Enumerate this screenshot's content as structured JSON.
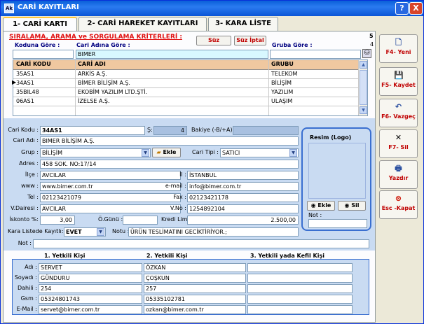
{
  "window": {
    "title": "CARİ KAYITLARI",
    "help_label": "?",
    "close_label": "X",
    "app_icon": "Ak"
  },
  "tabs": [
    {
      "label": "1- CARİ KARTI",
      "active": true
    },
    {
      "label": "2- CARİ HAREKET KAYITLARI",
      "active": false
    },
    {
      "label": "3- KARA LİSTE",
      "active": false
    }
  ],
  "search": {
    "heading": "SIRALAMA, ARAMA ve SORGULAMA KRİTERLERİ :",
    "filter_button": "Süz",
    "cancel_filter_button": "Süz İptal",
    "count_total": "5",
    "count_shown": "4",
    "code_label": "Koduna Göre :",
    "name_label": "Cari Adına Göre :",
    "group_label": "Gruba Göre :",
    "code_value": "",
    "name_value": "BIMER",
    "group_value": ""
  },
  "grid": {
    "columns": [
      "CARİ KODU",
      "CARİ ADI",
      "GRUBU"
    ],
    "rows": [
      {
        "code": "35AS1",
        "name": "ARKİS A.Ş.",
        "group": "TELEKOM",
        "selected": false
      },
      {
        "code": "34AS1",
        "name": "BİMER BİLİŞİM A.Ş.",
        "group": "BİLİŞİM",
        "selected": true
      },
      {
        "code": "35BIL48",
        "name": "EKOBİM YAZILIM LTD.ŞTİ.",
        "group": "YAZILIM",
        "selected": false
      },
      {
        "code": "06AS1",
        "name": "İZELSE A.Ş.",
        "group": "ULAŞIM",
        "selected": false
      }
    ]
  },
  "form": {
    "code_label": "Cari Kodu :",
    "code_value": "34AS1",
    "s_label": "Ş:",
    "s_value": "4",
    "balance_label": "Bakiye (-B/+A):",
    "balance_value": "",
    "name_label": "Cari Adı :",
    "name_value": "BIMER BİLİŞİM A.Ş.",
    "group_label": "Grup :",
    "group_value": "BİLİŞİM",
    "add_button": "Ekle",
    "type_label": "Cari Tipi :",
    "type_value": "SATICI",
    "address_label": "Adres :",
    "address_value": "458 SOK. NO:17/14",
    "district_label": "İlçe :",
    "district_value": "AVCILAR",
    "city_label": "İl :",
    "city_value": "İSTANBUL",
    "www_label": "www :",
    "www_value": "www.bimer.com.tr",
    "email_label": "e-mail :",
    "email_value": "info@bimer.com.tr",
    "tel_label": "Tel :",
    "tel_value": "02123421079",
    "fax_label": "Fax :",
    "fax_value": "02123421178",
    "taxoffice_label": "V.Dairesi :",
    "taxoffice_value": "AVCILAR",
    "taxno_label": "V.No :",
    "taxno_value": "1254892104",
    "discount_label": "İskonto %:",
    "discount_value": "3,00",
    "payday_label": "Ö.Günü :",
    "payday_value": "",
    "credit_label": "Kredi Limiti :",
    "credit_value": "2.500,00",
    "blacklist_label": "Kara Listede Kayıtlı:",
    "blacklist_value": "EVET",
    "note_label": "Notu :",
    "note_value": "ÜRÜN TESLİMATINI GECİKTİRİYOR.;",
    "not_label": "Not :",
    "not_value": ""
  },
  "photo": {
    "title": "Resim (Logo)",
    "add_button": "Ekle",
    "delete_button": "Sil",
    "note_label": "Not :",
    "note_value": ""
  },
  "contacts": {
    "headers": [
      "1. Yetkili Kişi",
      "2. Yetkili Kişi",
      "3. Yetkili yada Kefil Kişi"
    ],
    "row_labels": [
      "Adı :",
      "Soyadı :",
      "Dahili :",
      "Gsm :",
      "E-Mail :"
    ],
    "person1": [
      "SERVET",
      "GÜNDURU",
      "254",
      "05324801743",
      "servet@bimer.com.tr"
    ],
    "person2": [
      "ÖZKAN",
      "ÇOŞKUN",
      "257",
      "05335102781",
      "ozkan@bimer.com.tr"
    ],
    "person3": [
      "",
      "",
      "",
      "",
      ""
    ]
  },
  "side_buttons": [
    {
      "label": "F4- Yeni",
      "icon": "new-file-icon",
      "glyph": "🗋"
    },
    {
      "label": "F5- Kaydet",
      "icon": "save-icon",
      "glyph": "💾"
    },
    {
      "label": "F6- Vazgeç",
      "icon": "undo-icon",
      "glyph": "↶"
    },
    {
      "label": "F7- Sil",
      "icon": "delete-x-icon",
      "glyph": "✕"
    },
    {
      "label": "Yazdır",
      "icon": "print-icon",
      "glyph": "🖶"
    },
    {
      "label": "Esc -Kapat",
      "icon": "exit-icon",
      "glyph": "⊗"
    }
  ],
  "colors": {
    "accent_red": "#e01010",
    "panel_blue": "#c9dbf2",
    "grid_header": "#f0c8a0"
  }
}
